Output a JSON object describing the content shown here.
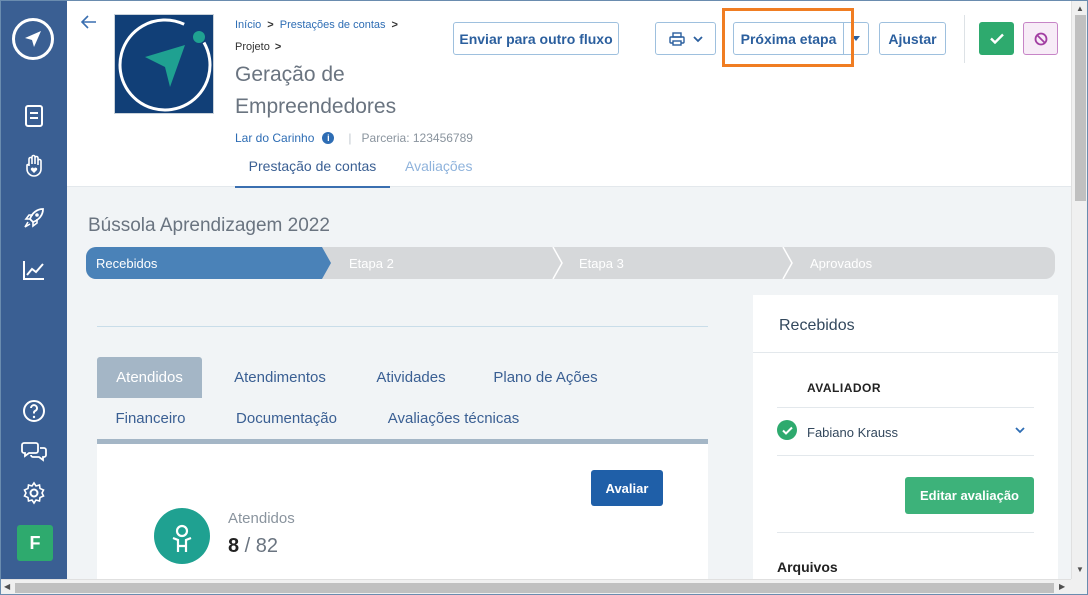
{
  "sidebar": {
    "avatar_letter": "F",
    "icons": [
      "logo-icon",
      "document-icon",
      "hand-heart-icon",
      "rocket-icon",
      "chart-icon",
      "help-icon",
      "chat-icon",
      "gear-icon"
    ]
  },
  "header": {
    "breadcrumb": [
      "Início",
      "Prestações de contas"
    ],
    "breadcrumb_sub": "Projeto",
    "project_title": "Geração de Empreendedores",
    "organization": "Lar do Carinho",
    "partnership": "Parceria: 123456789",
    "tabs": [
      {
        "label": "Prestação de contas",
        "active": true
      },
      {
        "label": "Avaliações",
        "active": false
      }
    ],
    "buttons": {
      "send_other_flow": "Enviar para outro fluxo",
      "next_step": "Próxima etapa",
      "adjust": "Ajustar"
    }
  },
  "main": {
    "section_title": "Bússola Aprendizagem 2022",
    "steps": [
      "Recebidos",
      "Etapa 2",
      "Etapa 3",
      "Aprovados"
    ],
    "active_step": 0,
    "content_tabs": [
      "Atendidos",
      "Atendimentos",
      "Atividades",
      "Plano de Ações",
      "Financeiro",
      "Documentação",
      "Avaliações técnicas"
    ],
    "active_content_tab": 0,
    "evaluate_button": "Avaliar",
    "attended": {
      "label": "Atendidos",
      "value": "8",
      "total": "82"
    }
  },
  "right_panel": {
    "title": "Recebidos",
    "evaluator_header": "AVALIADOR",
    "evaluator_name": "Fabiano Krauss",
    "edit_button": "Editar avaliação",
    "files_label": "Arquivos"
  },
  "colors": {
    "sidebar": "#3a5f93",
    "step_active": "#4a82b8",
    "step_inactive": "#d6d8da",
    "success": "#2eaa6e",
    "highlight": "#f07d22",
    "primary_button": "#1f5fa8"
  }
}
